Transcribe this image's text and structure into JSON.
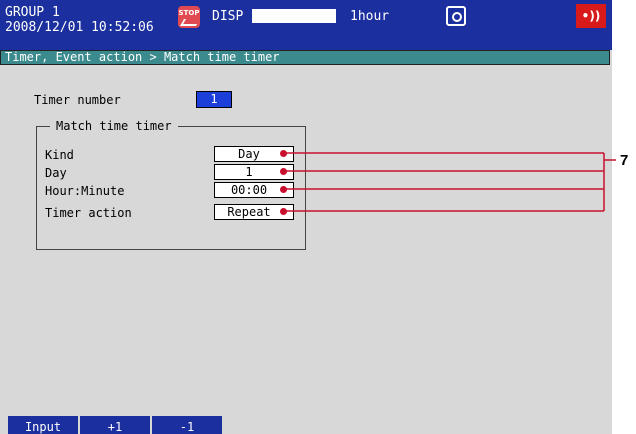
{
  "header": {
    "group": "GROUP 1",
    "datetime": "2008/12/01 10:52:06",
    "stop_label": "STOP",
    "disp_label": "DISP",
    "time_span": "1hour",
    "alarm_label": "•))"
  },
  "breadcrumb": "Timer, Event action > Match time timer",
  "timer": {
    "label": "Timer number",
    "value": "1"
  },
  "groupbox": {
    "title": "Match time timer"
  },
  "rows": [
    {
      "label": "Kind",
      "value": "Day"
    },
    {
      "label": "Day",
      "value": "1"
    },
    {
      "label": "Hour:Minute",
      "value": "00:00"
    },
    {
      "label": "Timer action",
      "value": "Repeat"
    }
  ],
  "softkeys": [
    "Input",
    "+1",
    "-1"
  ],
  "callout": "7",
  "colors": {
    "header_bg": "#1b2f9e",
    "breadcrumb_bg": "#3a8a8e",
    "screen_bg": "#d8d8d8",
    "callout_line": "#c8102e",
    "alarm": "#d81a1a"
  }
}
